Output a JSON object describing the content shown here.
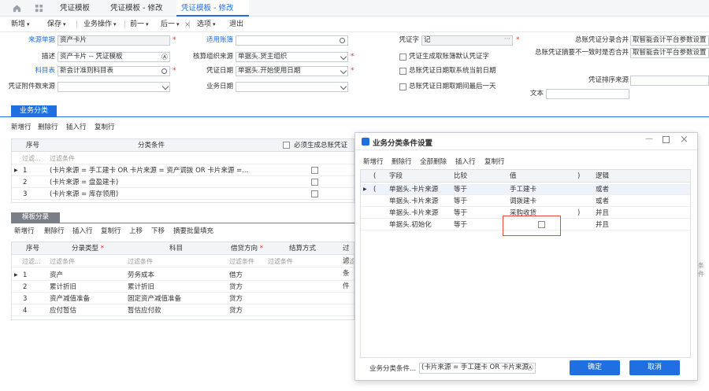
{
  "tabs": [
    {
      "label": "凭证模板"
    },
    {
      "label": "凭证模板 - 修改"
    },
    {
      "label": "凭证模板 - 修改",
      "closable": true,
      "active": true
    }
  ],
  "toolbar": {
    "new": "新增",
    "save": "保存",
    "biz": "业务操作",
    "prev": "前一",
    "next": "后一",
    "options": "选项",
    "exit": "退出"
  },
  "form": {
    "source_label": "来源单据",
    "source_value": "资产卡片",
    "apply_label": "适用账簿",
    "apply_value": "",
    "voucher_word_label": "凭证字",
    "voucher_word_value": "记",
    "gl_merge_label": "总账凭证分录合并",
    "gl_merge_value": "取智能会计平台参数设置",
    "desc_label": "描述",
    "desc_value": "资产卡片 -- 凭证模板",
    "acct_org_label": "核算组织来源",
    "acct_org_value": "单据头.货主组织",
    "chk1": "凭证生成取账簿默认凭证字",
    "gl_diff_label": "总账凭证摘要不一致时是否合并",
    "gl_diff_value": "取智能会计平台参数设置",
    "subject_label": "科目表",
    "subject_value": "新会计准则科目表",
    "vdate_label": "凭证日期",
    "vdate_value": "单据头.开始使用日期",
    "chk2": "总账凭证日期取系统当前日期",
    "attach_label": "凭证附件数来源",
    "attach_value": "",
    "bizdate_label": "业务日期",
    "bizdate_value": "",
    "chk3": "总账凭证日期取期间最后一天",
    "sort_label": "凭证排序来源",
    "sort_value": "",
    "text_label": "文本",
    "text_value": ""
  },
  "section1": {
    "title": "业务分类",
    "actions": [
      "新增行",
      "删除行",
      "插入行",
      "复制行"
    ],
    "headers": {
      "seq": "序号",
      "cond": "分类条件",
      "must": "必须生成总账凭证"
    },
    "filter": "过滤条件",
    "rows": [
      {
        "seq": "1",
        "cond": "(卡片来源 = 手工建卡  OR    卡片来源 = 资产调拨  OR 卡片来源 =..."
      },
      {
        "seq": "2",
        "cond": "(卡片来源 = 盘盈建卡)"
      },
      {
        "seq": "3",
        "cond": "(卡片来源 = 库存领用)"
      }
    ]
  },
  "section2": {
    "title": "模板分录",
    "actions": [
      "新增行",
      "删除行",
      "插入行",
      "复制行",
      "上移",
      "下移",
      "摘要批量填充"
    ],
    "headers": {
      "seq": "序号",
      "type": "分录类型",
      "subject": "科目",
      "dir": "借贷方向",
      "settle": "结算方式",
      "filter": "过滤条件"
    },
    "filter": "过滤条件",
    "rows": [
      {
        "seq": "1",
        "type": "资产",
        "subject": "劳务成本",
        "dir": "借方"
      },
      {
        "seq": "2",
        "type": "累计折旧",
        "subject": "累计折旧",
        "dir": "贷方"
      },
      {
        "seq": "3",
        "type": "资产减值准备",
        "subject": "固定资产减值准备",
        "dir": "贷方"
      },
      {
        "seq": "4",
        "type": "应付暂估",
        "subject": "暂估应付款",
        "dir": "贷方"
      }
    ]
  },
  "dialog": {
    "title": "业务分类条件设置",
    "actions": [
      "新增行",
      "删除行",
      "全部删除",
      "插入行",
      "复制行"
    ],
    "headers": {
      "lp": "(",
      "field": "字段",
      "cmp": "比较",
      "val": "值",
      "rp": ")",
      "logic": "逻辑"
    },
    "rows": [
      {
        "lp": "(",
        "field": "单据头.卡片来源",
        "cmp": "等于",
        "val": "手工建卡",
        "rp": "",
        "logic": "或者"
      },
      {
        "lp": "",
        "field": "单据头.卡片来源",
        "cmp": "等于",
        "val": "调拨建卡",
        "rp": "",
        "logic": "或者"
      },
      {
        "lp": "",
        "field": "单据头.卡片来源",
        "cmp": "等于",
        "val": "采购收货",
        "rp": ")",
        "logic": "并且"
      },
      {
        "lp": "",
        "field": "单据头.初始化",
        "cmp": "等于",
        "val": "",
        "rp": "",
        "logic": "并且"
      }
    ],
    "footer_label": "业务分类条件...",
    "footer_value": "(卡片来源 = 手工建卡  OR   卡片来源",
    "ok": "确定",
    "cancel": "取消"
  },
  "colors": {
    "accent": "#1f6fe0",
    "highlight": "#e8493b"
  }
}
